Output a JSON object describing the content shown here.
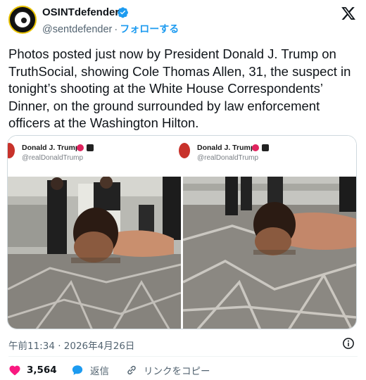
{
  "author": {
    "name": "OSINTdefender",
    "handle": "@sentdefender",
    "separator": "·",
    "follow_label": "フォローする",
    "verified": true,
    "avatar_icon": "eye-logo-avatar"
  },
  "tweet": {
    "text": "Photos posted just now by President Donald J. Trump on TruthSocial, showing Cole Thomas Allen, 31, the suspect in tonight’s shooting at the White House Correspondents’ Dinner, on the ground surrounded by law enforcement officers at the Washington Hilton."
  },
  "media": [
    {
      "poster_name": "Donald J. Trump",
      "poster_handle": "@realDonaldTrump"
    },
    {
      "poster_name": "Donald J. Trump",
      "poster_handle": "@realDonaldTrump"
    }
  ],
  "meta": {
    "timestamp": "午前11:34 · 2026年4月26日"
  },
  "actions": {
    "like_count": "3,564",
    "reply_label": "返信",
    "copy_link_label": "リンクをコピー"
  },
  "colors": {
    "accent": "#1d9bf0",
    "like": "#f91880",
    "text": "#0f1419",
    "muted": "#536471"
  }
}
